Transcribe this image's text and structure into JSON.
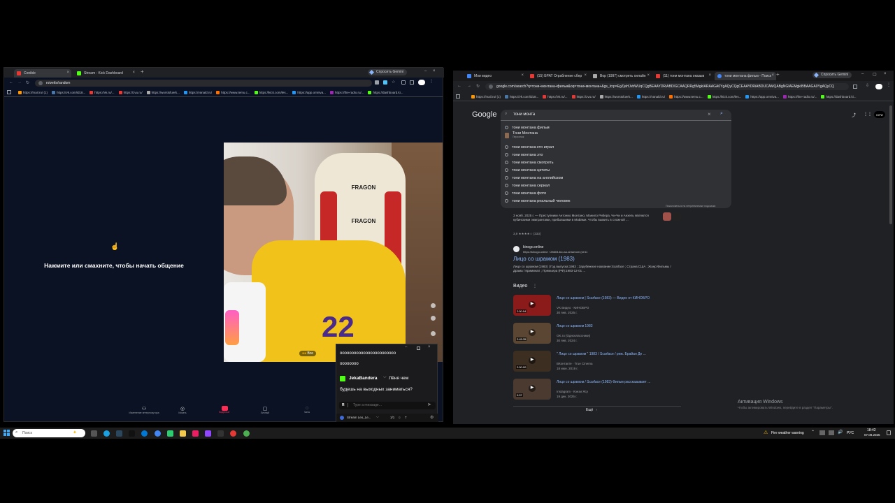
{
  "left_window": {
    "tabs": [
      {
        "label": "Conible",
        "color": "#e53935"
      },
      {
        "label": "Stream - Kick Dashboard",
        "color": "#53fc18"
      }
    ],
    "gemini_button": "Спросить Gemini",
    "url": "roivettv/random",
    "bookmarks": [
      {
        "label": "https://mail.ru/ (1)",
        "color": "#ff9800"
      },
      {
        "label": "https://vk.com/id18...",
        "color": "#4a76a8"
      },
      {
        "label": "https://vk.ru/...",
        "color": "#e53935"
      },
      {
        "label": "https://zvu.ru/",
        "color": "#e53935"
      },
      {
        "label": "https://worstsfuerk...",
        "color": "#aaaaaa"
      },
      {
        "label": "https://vanald.ru/",
        "color": "#2196f3"
      },
      {
        "label": "https://www.temu.c...",
        "color": "#ff6f00"
      },
      {
        "label": "https://kick.com/les...",
        "color": "#53fc18"
      },
      {
        "label": "https://app.omniva...",
        "color": "#2196f3"
      },
      {
        "label": "https://the-radio.ru/...",
        "color": "#9c27b0"
      },
      {
        "label": "https://dashboard.ki...",
        "color": "#53fc18"
      }
    ],
    "prompt_text": "Нажмите или смахните, чтобы начать общение",
    "video_badge": "Все",
    "bottom_nav": [
      {
        "label": "Изменение интерлокутора",
        "icon": "people-icon"
      },
      {
        "label": "Искать",
        "icon": "search-icon"
      },
      {
        "label": "Видеочат",
        "icon": "video-icon"
      },
      {
        "label": "Личный",
        "icon": "inbox-icon"
      },
      {
        "label": "Чаты",
        "icon": "chat-icon"
      }
    ]
  },
  "chat_popup": {
    "message1": "оооооооооооооооооооооооо",
    "message1_cont": "оооооооо",
    "username": "JekaBandera",
    "message2_start": "Лёня чем",
    "message2_cont": "будешь на выходных заниматься?",
    "input_placeholder": "Type a message...",
    "stream_label": "Stream Leo_Le...",
    "page": "1/1",
    "count": "7"
  },
  "right_window": {
    "tabs": [
      {
        "label": "Мои видео",
        "color": "#4285f4"
      },
      {
        "label": "(15) БРАТ Ограбление сбер",
        "color": "#e53935"
      },
      {
        "label": "Вор (1997) смотреть онлайн",
        "color": "#aaaaaa"
      },
      {
        "label": "(11) тони монтана оказыв",
        "color": "#e53935"
      },
      {
        "label": "тони монтана фильм - Поиск",
        "color": "#4285f4"
      }
    ],
    "gemini_button": "Спросить Gemini",
    "url": "google.com/search?q=тони+монтана+фильм&oq=тони+монтана+&gs_lcrp=EgZjaHJvbWUqCQgBEAAYDRiABDIGCAAQRRg5MgkIARAAGA0YgAQyCQgCEAAYDRiABDIJCAMQABgNGIAEMgkIBBAAGA0YgAQyCQ",
    "logo": "Google",
    "search_query": "тони монта",
    "suggestions": [
      "тони монтана фильм",
      "Тони Монтана",
      "тони монтана кто играл",
      "тони монтана это",
      "тони монтана смотреть",
      "тони монтана цитаты",
      "тони монтана на английском",
      "тони монтана сериал",
      "тони монтана фото",
      "тони монтана реальный человек"
    ],
    "suggestion_sub": "Персонаж",
    "report_text": "Пожаловаться на неприемлемые подсказки",
    "snippet": "3 нояб. 2025 г. — Преступники Антонио Монтано, Манило Рибера, Чи-Чи и Анхель являются кубинскими эмигрантами, прибывшими в Майами. Чтобы выжить в сложной ...",
    "rating": "3,9 ★★★★☆ (333)",
    "result_site": "kinogo.online",
    "result_url": "https://kinogo.online › 28603-lico-so-shramom (id 61",
    "result_title": "Лицо со шрамом (1983)",
    "result_desc": "Лицо со шрамом (1983) | Год выпуска:1983 ; Зарубежное название:Scarface ; Страна:США ; Жанр:Фильмы / Драма / Криминал ; Премьера (РФ):1983-12-01 ...",
    "videos_heading": "Видео",
    "videos": [
      {
        "title": "Лицо со шрамом | Scarface (1983) — Видео от КИНОБРО",
        "source": "VK Видео · КИНОБРО",
        "date": "30 янв. 2025 г.",
        "duration": "2:50:54",
        "color": "#8b1a1a"
      },
      {
        "title": "Лицо со шрамом 1983",
        "source": "OK.ru (Одноклассники)",
        "date": "30 янв. 2024 г.",
        "duration": "2:45:35",
        "color": "#5a4632"
      },
      {
        "title": "\" Лицо со шрамом \" 1983 / Scarface / реж. Брайан Де ...",
        "source": "ВКонтакте · True Cinema",
        "date": "18 июн. 2019 г.",
        "duration": "2:50:00",
        "color": "#3d2e22"
      },
      {
        "title": "Лицо со шрамом / Scarface (1983) Фильм рассказывает ...",
        "source": "Instagram · Кэнзи Ясу",
        "date": "19 дек. 2025 г.",
        "duration": "0:57",
        "color": "#4a3a30"
      }
    ],
    "more_button": "Ещё",
    "activation_title": "Активация Windows",
    "activation_sub": "Чтобы активировать Windows, перейдите в раздел \"Параметры\"."
  },
  "taskbar": {
    "search_placeholder": "Поиск",
    "weather": "Fire weather warning",
    "lang": "РУС",
    "time": "18:42",
    "date": "07.08.2025"
  }
}
